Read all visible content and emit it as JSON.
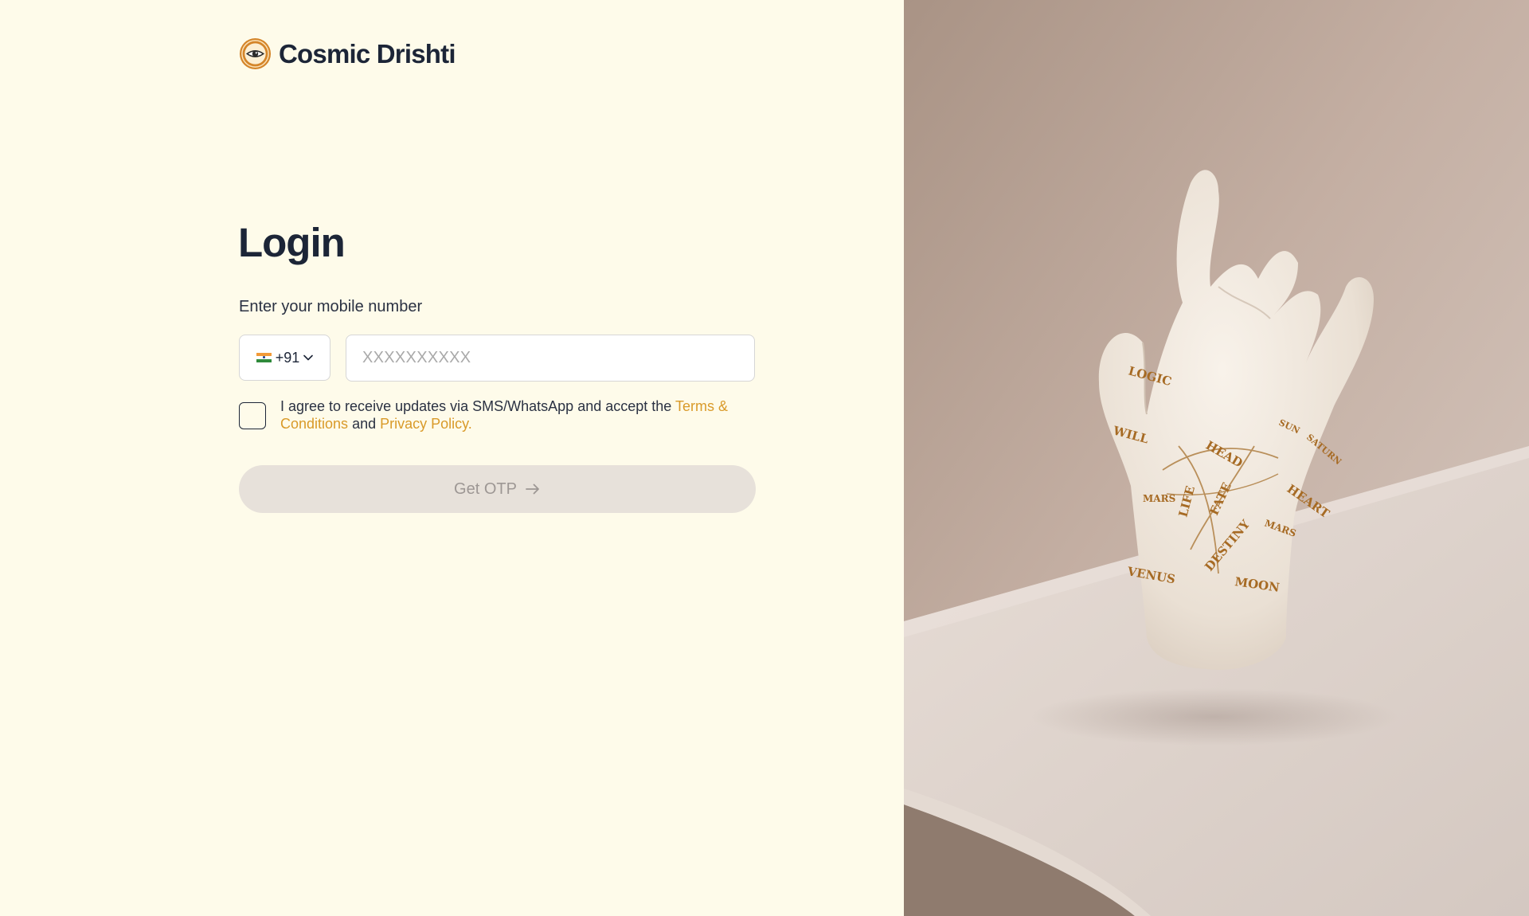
{
  "brand": {
    "name": "Cosmic Drishti",
    "logo_icon": "eye-emblem-icon"
  },
  "login": {
    "title": "Login",
    "phone_label": "Enter your mobile number",
    "country": {
      "flag_icon": "india-flag-icon",
      "code": "+91"
    },
    "phone_input": {
      "value": "",
      "placeholder": "XXXXXXXXXX"
    },
    "consent": {
      "checked": false,
      "text_before": "I agree to receive updates via SMS/WhatsApp and accept the ",
      "terms_link": "Terms & Conditions",
      "text_middle": " and ",
      "privacy_link": "Privacy Policy."
    },
    "submit_button": {
      "label": "Get OTP",
      "enabled": false,
      "icon": "arrow-right-icon"
    }
  },
  "hero_image": {
    "subject": "palmistry-hand-figurine",
    "engraved_text": [
      "LOGIC",
      "WILL",
      "HEAD",
      "HEART",
      "LIFE",
      "FATE",
      "DESTINY",
      "MARS",
      "MARS",
      "VENUS",
      "MOON",
      "SUN",
      "SATURN"
    ]
  },
  "colors": {
    "page_background": "#FEFBEA",
    "text_primary": "#1C2537",
    "link_accent": "#D99A29",
    "button_disabled_bg": "#E7E1DA",
    "button_disabled_text": "#9D9794",
    "input_border": "#D6D6D6"
  }
}
